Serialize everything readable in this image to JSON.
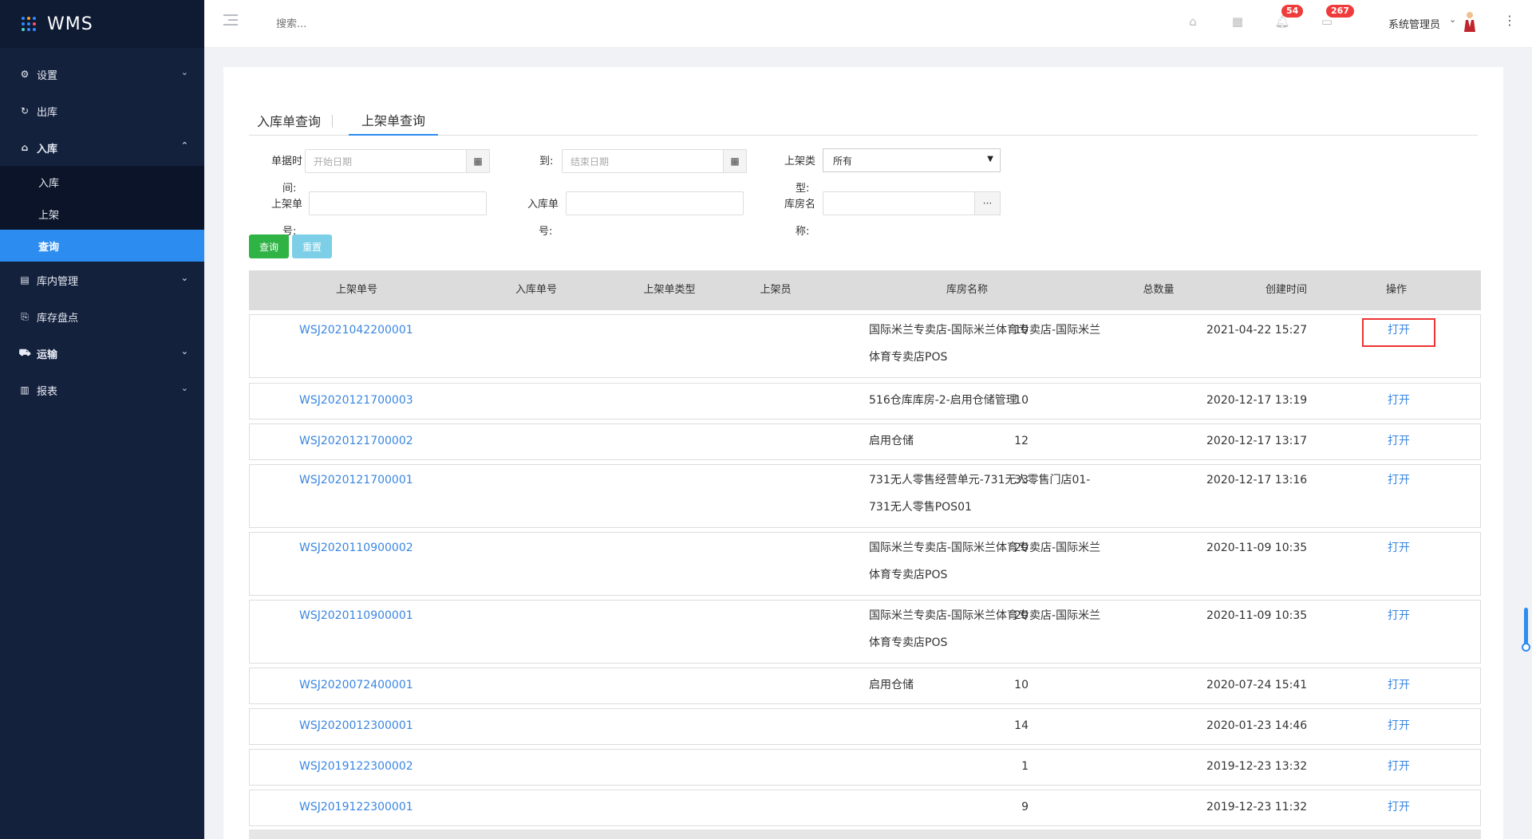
{
  "app": {
    "title": "WMS"
  },
  "sidebar": {
    "items": [
      {
        "label": "设置",
        "icon": "gear-icon"
      },
      {
        "label": "出库",
        "icon": "outbound-icon"
      },
      {
        "label": "入库",
        "icon": "home-icon"
      },
      {
        "label": "库内管理",
        "icon": "inventory-icon"
      },
      {
        "label": "库存盘点",
        "icon": "stocktake-icon"
      },
      {
        "label": "运输",
        "icon": "truck-icon"
      },
      {
        "label": "报表",
        "icon": "bar-chart-icon"
      }
    ],
    "subitems": [
      {
        "label": "入库"
      },
      {
        "label": "上架"
      },
      {
        "label": "查询"
      }
    ]
  },
  "topbar": {
    "search_placeholder": "搜索...",
    "notifications_count": "54",
    "messages_count": "267",
    "user_name": "系统管理员"
  },
  "tabs": [
    {
      "label": "入库单查询"
    },
    {
      "label": "上架单查询"
    }
  ],
  "filters": {
    "date_label_1": "单据时",
    "date_label_2": "间:",
    "start_placeholder": "开始日期",
    "to_label": "到:",
    "end_placeholder": "结束日期",
    "type_label_1": "上架类",
    "type_label_2": "型:",
    "type_value": "所有",
    "putaway_no_label_1": "上架单",
    "putaway_no_label_2": "号:",
    "inbound_no_label_1": "入库单",
    "inbound_no_label_2": "号:",
    "warehouse_label_1": "库房名",
    "warehouse_label_2": "称:",
    "query_button": "查询",
    "reset_button": "重置"
  },
  "table": {
    "headers": [
      "上架单号",
      "入库单号",
      "上架单类型",
      "上架员",
      "库房名称",
      "总数量",
      "创建时间",
      "操作"
    ],
    "rows": [
      {
        "code": "WSJ2021042200001",
        "warehouse": "国际米兰专卖店-国际米兰体育专卖店-国际米兰体育专卖店POS",
        "qty": "10",
        "created": "2021-04-22 15:27",
        "action": "打开"
      },
      {
        "code": "WSJ2020121700003",
        "warehouse": "516仓库库房-2-启用仓储管理",
        "qty": "10",
        "created": "2020-12-17 13:19",
        "action": "打开"
      },
      {
        "code": "WSJ2020121700002",
        "warehouse": "启用仓储",
        "qty": "12",
        "created": "2020-12-17 13:17",
        "action": "打开"
      },
      {
        "code": "WSJ2020121700001",
        "warehouse": "731无人零售经营单元-731无人零售门店01-731无人零售POS01",
        "qty": "33",
        "created": "2020-12-17 13:16",
        "action": "打开"
      },
      {
        "code": "WSJ2020110900002",
        "warehouse": "国际米兰专卖店-国际米兰体育专卖店-国际米兰体育专卖店POS",
        "qty": "20",
        "created": "2020-11-09 10:35",
        "action": "打开"
      },
      {
        "code": "WSJ2020110900001",
        "warehouse": "国际米兰专卖店-国际米兰体育专卖店-国际米兰体育专卖店POS",
        "qty": "20",
        "created": "2020-11-09 10:35",
        "action": "打开"
      },
      {
        "code": "WSJ2020072400001",
        "warehouse": "启用仓储",
        "qty": "10",
        "created": "2020-07-24 15:41",
        "action": "打开"
      },
      {
        "code": "WSJ2020012300001",
        "warehouse": "",
        "qty": "14",
        "created": "2020-01-23 14:46",
        "action": "打开"
      },
      {
        "code": "WSJ2019122300002",
        "warehouse": "",
        "qty": "1",
        "created": "2019-12-23 13:32",
        "action": "打开"
      },
      {
        "code": "WSJ2019122300001",
        "warehouse": "",
        "qty": "9",
        "created": "2019-12-23 11:32",
        "action": "打开"
      }
    ]
  },
  "colors": {
    "sidebar_bg": "#14213d",
    "accent": "#2d8cf0",
    "link": "#3a86e0",
    "query_btn": "#2fb344",
    "reset_btn": "#7ccfe6",
    "highlight": "#ee3333"
  }
}
